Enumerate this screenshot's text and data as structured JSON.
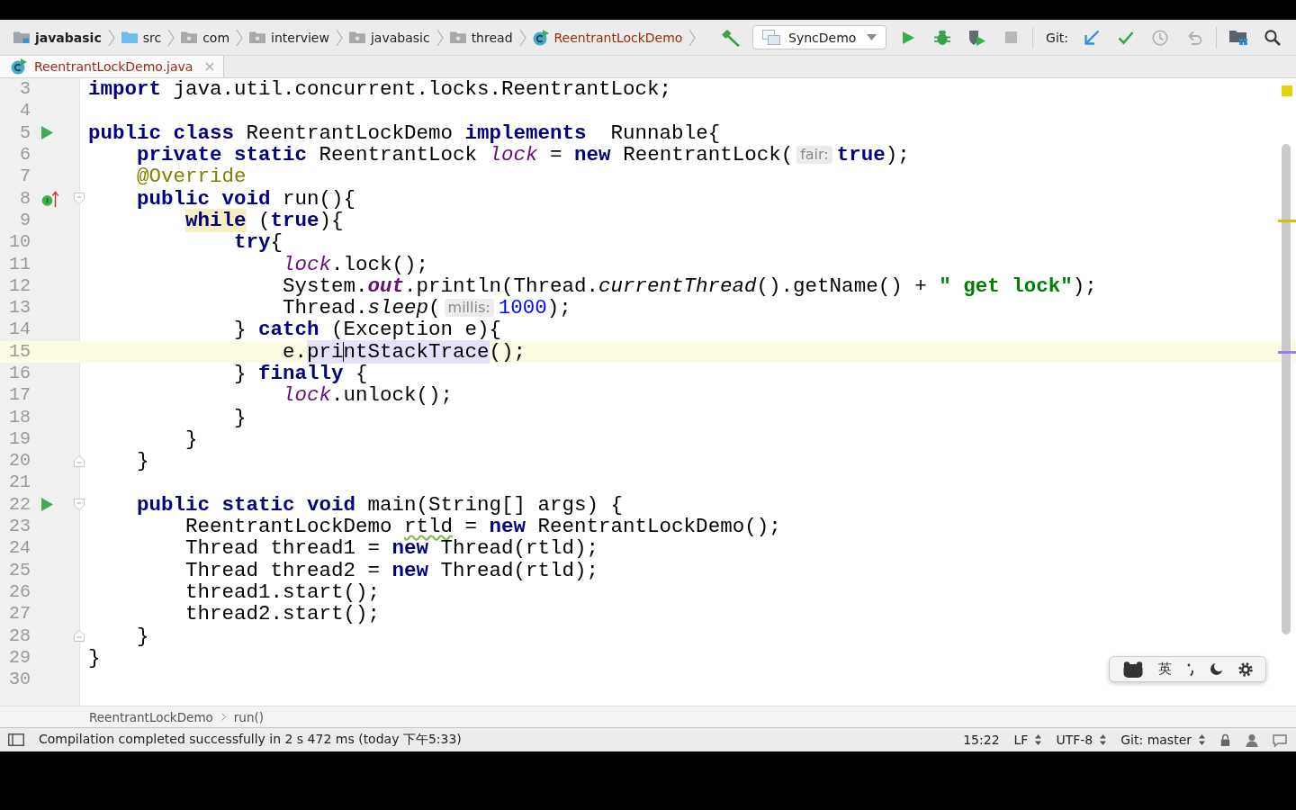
{
  "navigation_bar": {
    "breadcrumbs": [
      {
        "label": "javabasic",
        "kind": "module"
      },
      {
        "label": "src",
        "kind": "source-folder"
      },
      {
        "label": "com",
        "kind": "package"
      },
      {
        "label": "interview",
        "kind": "package"
      },
      {
        "label": "javabasic",
        "kind": "package"
      },
      {
        "label": "thread",
        "kind": "package"
      },
      {
        "label": "ReentrantLockDemo",
        "kind": "class"
      }
    ],
    "build_tools": [
      {
        "kind": "build",
        "disabled": false
      }
    ],
    "run_configuration": {
      "label": "SyncDemo"
    },
    "run_tools": [
      {
        "kind": "run",
        "disabled": false
      },
      {
        "kind": "debug",
        "disabled": false
      },
      {
        "kind": "coverage",
        "disabled": false
      },
      {
        "kind": "stop",
        "disabled": true
      }
    ],
    "vcs": {
      "label": "Git:",
      "tools": [
        {
          "kind": "update",
          "disabled": false
        },
        {
          "kind": "commit",
          "disabled": false
        },
        {
          "kind": "history",
          "disabled": true
        },
        {
          "kind": "rollback",
          "disabled": true
        }
      ]
    },
    "tools": [
      {
        "kind": "project-structure",
        "disabled": false
      },
      {
        "kind": "search",
        "disabled": false
      }
    ]
  },
  "editor_tabs": [
    {
      "label": "ReentrantLockDemo.java",
      "kind": "class",
      "selected": true
    }
  ],
  "editor": {
    "lines": [
      {
        "number": "3",
        "current": false,
        "tokens": [
          {
            "kind": "keyword",
            "text": "import"
          },
          {
            "kind": "plain",
            "text": " java.util.concurrent.locks.ReentrantLock;"
          }
        ]
      },
      {
        "number": "4",
        "current": false
      },
      {
        "number": "5",
        "current": false,
        "gutter": [
          {
            "kind": "run"
          }
        ],
        "tokens": [
          {
            "kind": "keyword",
            "text": "public class"
          },
          {
            "kind": "plain",
            "text": " ReentrantLockDemo "
          },
          {
            "kind": "keyword",
            "text": "implements"
          },
          {
            "kind": "plain",
            "text": "  Runnable{"
          }
        ]
      },
      {
        "number": "6",
        "current": false,
        "tokens": [
          {
            "kind": "keyword",
            "text": "    private static"
          },
          {
            "kind": "plain",
            "text": " ReentrantLock "
          },
          {
            "kind": "field",
            "text": "lock"
          },
          {
            "kind": "plain",
            "text": " = "
          },
          {
            "kind": "keyword",
            "text": "new"
          },
          {
            "kind": "plain",
            "text": " ReentrantLock("
          },
          {
            "kind": "hint",
            "text": "fair:"
          },
          {
            "kind": "keyword",
            "text": "true"
          },
          {
            "kind": "plain",
            "text": ");"
          }
        ]
      },
      {
        "number": "7",
        "current": false,
        "tokens": [
          {
            "kind": "annotation",
            "text": "    @Override"
          }
        ]
      },
      {
        "number": "8",
        "current": false,
        "gutter": [
          {
            "kind": "implements"
          },
          {
            "kind": "fold-start"
          }
        ],
        "tokens": [
          {
            "kind": "keyword",
            "text": "    public void"
          },
          {
            "kind": "plain",
            "text": " run(){"
          }
        ]
      },
      {
        "number": "9",
        "current": false,
        "tokens": [
          {
            "kind": "warning",
            "text": "        while"
          },
          {
            "kind": "plain",
            "text": " ("
          },
          {
            "kind": "keyword",
            "text": "true"
          },
          {
            "kind": "plain",
            "text": "){"
          }
        ]
      },
      {
        "number": "10",
        "current": false,
        "tokens": [
          {
            "kind": "keyword",
            "text": "            try"
          },
          {
            "kind": "plain",
            "text": "{"
          }
        ]
      },
      {
        "number": "11",
        "current": false,
        "tokens": [
          {
            "kind": "field",
            "text": "                lock"
          },
          {
            "kind": "plain",
            "text": ".lock();"
          }
        ]
      },
      {
        "number": "12",
        "current": false,
        "tokens": [
          {
            "kind": "plain",
            "text": "                System."
          },
          {
            "kind": "constant",
            "text": "out"
          },
          {
            "kind": "plain",
            "text": ".println(Thread."
          },
          {
            "kind": "static-call",
            "text": "currentThread"
          },
          {
            "kind": "plain",
            "text": "().getName() + "
          },
          {
            "kind": "string",
            "text": "\" get lock\""
          },
          {
            "kind": "plain",
            "text": ");"
          }
        ]
      },
      {
        "number": "13",
        "current": false,
        "tokens": [
          {
            "kind": "plain",
            "text": "                Thread."
          },
          {
            "kind": "static-call",
            "text": "sleep"
          },
          {
            "kind": "plain",
            "text": "("
          },
          {
            "kind": "hint",
            "text": "millis:"
          },
          {
            "kind": "number",
            "text": "1000"
          },
          {
            "kind": "plain",
            "text": ");"
          }
        ]
      },
      {
        "number": "14",
        "current": false,
        "tokens": [
          {
            "kind": "plain",
            "text": "            } "
          },
          {
            "kind": "keyword",
            "text": "catch"
          },
          {
            "kind": "plain",
            "text": " (Exception e){"
          }
        ]
      },
      {
        "number": "15",
        "current": true,
        "tokens": [
          {
            "kind": "plain",
            "text": "                e."
          },
          {
            "kind": "usage",
            "text": "pri"
          },
          {
            "kind": "caret"
          },
          {
            "kind": "usage",
            "text": "ntStackTrace"
          },
          {
            "kind": "plain",
            "text": "();"
          }
        ]
      },
      {
        "number": "16",
        "current": false,
        "tokens": [
          {
            "kind": "plain",
            "text": "            } "
          },
          {
            "kind": "keyword",
            "text": "finally"
          },
          {
            "kind": "plain",
            "text": " {"
          }
        ]
      },
      {
        "number": "17",
        "current": false,
        "tokens": [
          {
            "kind": "field",
            "text": "                lock"
          },
          {
            "kind": "plain",
            "text": ".unlock();"
          }
        ]
      },
      {
        "number": "18",
        "current": false,
        "tokens": [
          {
            "kind": "plain",
            "text": "            }"
          }
        ]
      },
      {
        "number": "19",
        "current": false,
        "tokens": [
          {
            "kind": "plain",
            "text": "        }"
          }
        ]
      },
      {
        "number": "20",
        "current": false,
        "gutter": [
          {
            "kind": "fold-end"
          }
        ],
        "tokens": [
          {
            "kind": "plain",
            "text": "    }"
          }
        ]
      },
      {
        "number": "21",
        "current": false
      },
      {
        "number": "22",
        "current": false,
        "gutter": [
          {
            "kind": "run"
          },
          {
            "kind": "fold-start"
          }
        ],
        "tokens": [
          {
            "kind": "keyword",
            "text": "    public static void"
          },
          {
            "kind": "plain",
            "text": " main(String[] args) {"
          }
        ]
      },
      {
        "number": "23",
        "current": false,
        "tokens": [
          {
            "kind": "plain",
            "text": "        ReentrantLockDemo "
          },
          {
            "kind": "typo",
            "text": "rtld"
          },
          {
            "kind": "plain",
            "text": " = "
          },
          {
            "kind": "keyword",
            "text": "new"
          },
          {
            "kind": "plain",
            "text": " ReentrantLockDemo();"
          }
        ]
      },
      {
        "number": "24",
        "current": false,
        "tokens": [
          {
            "kind": "plain",
            "text": "        Thread thread1 = "
          },
          {
            "kind": "keyword",
            "text": "new"
          },
          {
            "kind": "plain",
            "text": " Thread(rtld);"
          }
        ]
      },
      {
        "number": "25",
        "current": false,
        "tokens": [
          {
            "kind": "plain",
            "text": "        Thread thread2 = "
          },
          {
            "kind": "keyword",
            "text": "new"
          },
          {
            "kind": "plain",
            "text": " Thread(rtld);"
          }
        ]
      },
      {
        "number": "26",
        "current": false,
        "tokens": [
          {
            "kind": "plain",
            "text": "        thread1.start();"
          }
        ]
      },
      {
        "number": "27",
        "current": false,
        "tokens": [
          {
            "kind": "plain",
            "text": "        thread2.start();"
          }
        ]
      },
      {
        "number": "28",
        "current": false,
        "gutter": [
          {
            "kind": "fold-end"
          }
        ],
        "tokens": [
          {
            "kind": "plain",
            "text": "    }"
          }
        ]
      },
      {
        "number": "29",
        "current": false,
        "tokens": [
          {
            "kind": "plain",
            "text": "}"
          }
        ]
      },
      {
        "number": "30",
        "current": false
      }
    ]
  },
  "editor_breadcrumbs": [
    "ReentrantLockDemo",
    "run()"
  ],
  "status_bar": {
    "message": "Compilation completed successfully in 2 s 472 ms (today 下午5:33)",
    "position": "15:22",
    "line_separator": "LF",
    "encoding": "UTF-8",
    "vcs_branch": "Git: master"
  },
  "input_method_bar": {
    "mode": "英"
  }
}
